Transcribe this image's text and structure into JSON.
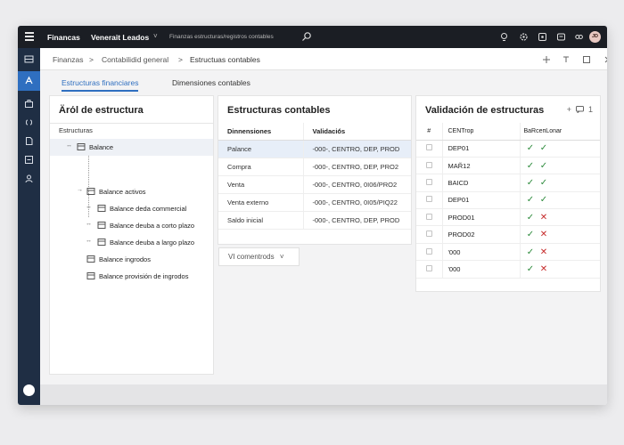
{
  "topbar": {
    "app_name": "Financas",
    "environment": "Venerait Leados",
    "env_chevron": "˅",
    "breadcrumb": "Finanzas estructuras/registros contables",
    "avatar_initials": "JD"
  },
  "breadcrumb": {
    "items": [
      "Finanzas",
      "Contabilidid general",
      "Estructuas contables"
    ],
    "separator": ">"
  },
  "tabs": [
    {
      "label": "Estructuras financiares",
      "active": true
    },
    {
      "label": "Dimensiones contables",
      "active": false
    }
  ],
  "tree_panel": {
    "title": "Ärόl de estructura",
    "section_label": "Estructuras",
    "nodes": [
      {
        "label": "Balance",
        "prefix": "↔",
        "selected": true
      },
      {
        "label": "Balance activos",
        "prefix": "→"
      },
      {
        "label": "Balance deda commercial",
        "prefix": "↔"
      },
      {
        "label": "Balance deuba a corto plazo",
        "prefix": "↔"
      },
      {
        "label": "Balance deuba a largo plazo",
        "prefix": "↔"
      },
      {
        "label": "Balance ingrodos",
        "prefix": ""
      },
      {
        "label": "Balance provisión de ingrodos",
        "prefix": ""
      }
    ]
  },
  "structures_panel": {
    "title": "Estructuras contables",
    "columns": [
      "Dinnensiones",
      "Validació́s"
    ],
    "rows": [
      {
        "name": "Palance",
        "validation": "-000-, CENTRO, DEP, PROD",
        "selected": true
      },
      {
        "name": "Compra",
        "validation": "-000-, CENTRO, DEP, PRO2"
      },
      {
        "name": "Venta",
        "validation": "-000-, CENTRO, 0I06/PRO2"
      },
      {
        "name": "Venta externo",
        "validation": "-000-, CENTRO, 0I05/PIQ22"
      },
      {
        "name": "Saldo inicial",
        "validation": "-000-, CENTRO, DEP, PROD"
      }
    ],
    "view_button": "VI comentrods",
    "view_chevron": "˅"
  },
  "validation_panel": {
    "title": "Validación de estructuras",
    "actions": {
      "add": "+",
      "comment": "1"
    },
    "columns": [
      "#",
      "CENTrор",
      "BaRceпLonar"
    ],
    "rows": [
      {
        "code": "DEP01",
        "checks": [
          "ok",
          "ok"
        ]
      },
      {
        "code": "MAR᷉12",
        "checks": [
          "ok",
          "ok"
        ]
      },
      {
        "code": "BAICD",
        "checks": [
          "ok",
          "ok"
        ]
      },
      {
        "code": "DEP01",
        "checks": [
          "ok",
          "ok"
        ]
      },
      {
        "code": "PROD01",
        "checks": [
          "ok",
          "bad"
        ]
      },
      {
        "code": "PROD02",
        "checks": [
          "ok",
          "bad"
        ]
      },
      {
        "code": "'000",
        "checks": [
          "ok",
          "bad"
        ]
      },
      {
        "code": "'000",
        "checks": [
          "ok",
          "bad"
        ]
      }
    ]
  },
  "colors": {
    "topbar": "#1b1e24",
    "rail": "#1f2e44",
    "accent": "#2f6fc0",
    "ok": "#2e8b3d",
    "bad": "#c62b2b"
  }
}
